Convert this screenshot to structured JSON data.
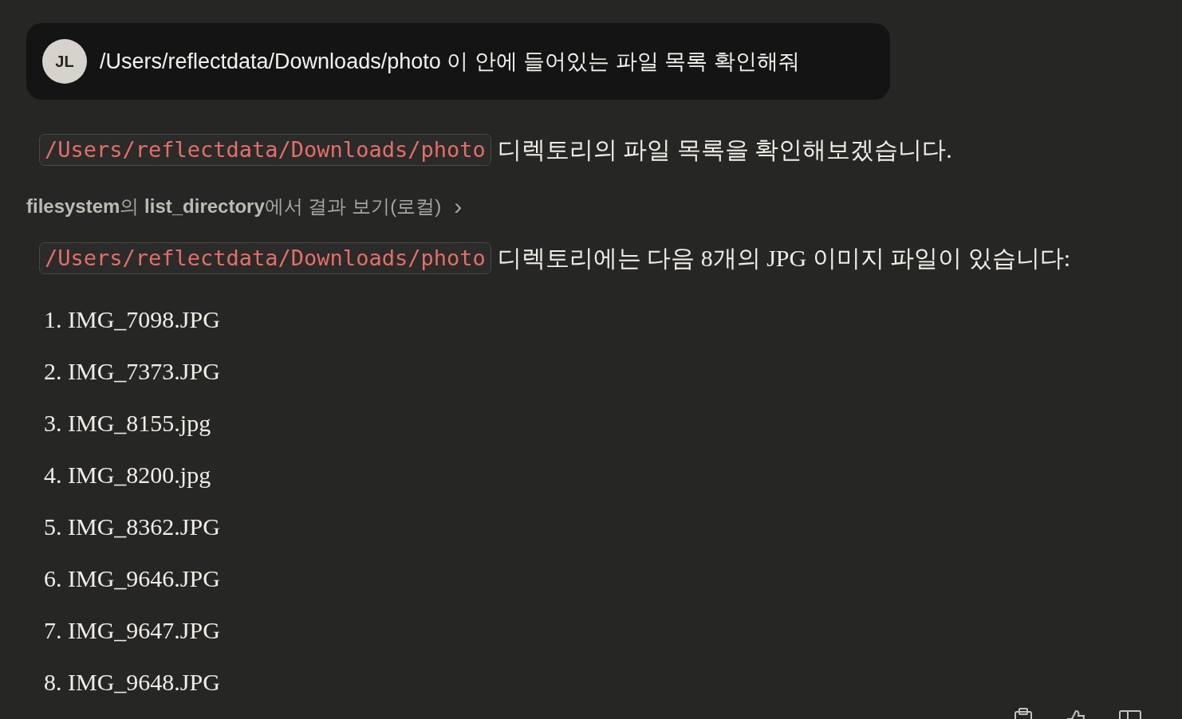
{
  "user_message": {
    "avatar": "JL",
    "text": "/Users/reflectdata/Downloads/photo 이 안에 들어있는 파일 목록 확인해줘"
  },
  "intro": {
    "code": "/Users/reflectdata/Downloads/photo",
    "text": "디렉토리의 파일 목록을 확인해보겠습니다."
  },
  "tool_result": {
    "label": "**filesystem**의 **list_directory**에서 결과 보기(로컬)",
    "chevron": "›"
  },
  "summary": {
    "code": "/Users/reflectdata/Downloads/photo",
    "text": "디렉토리에는 다음 8개의 JPG 이미지 파일이 있습니다:"
  },
  "files": [
    {
      "number": "1.",
      "name": "IMG_7098.JPG"
    },
    {
      "number": "2.",
      "name": "IMG_7373.JPG"
    },
    {
      "number": "3.",
      "name": "IMG_8155.jpg"
    },
    {
      "number": "4.",
      "name": "IMG_8200.jpg"
    },
    {
      "number": "5.",
      "name": "IMG_8362.JPG"
    },
    {
      "number": "6.",
      "name": "IMG_9646.JPG"
    },
    {
      "number": "7.",
      "name": "IMG_9647.JPG"
    },
    {
      "number": "8.",
      "name": "IMG_9648.JPG"
    }
  ]
}
